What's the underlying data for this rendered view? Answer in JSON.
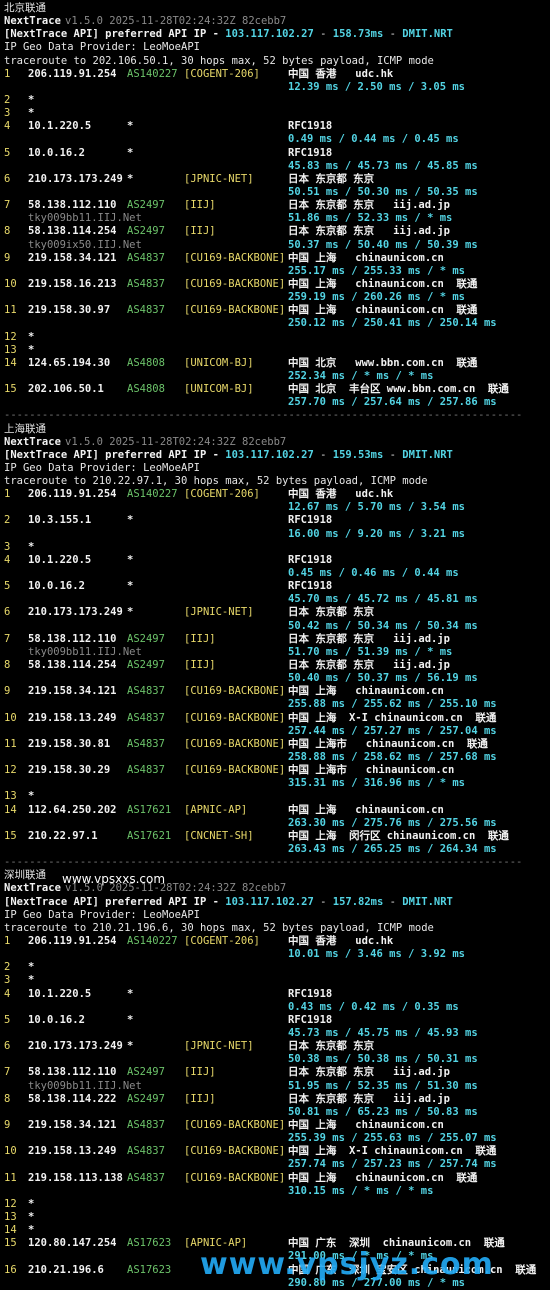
{
  "sections": [
    {
      "region": "北京联通",
      "header": {
        "app": "NextTrace",
        "version": "v1.5.0 2025-11-28T02:24:32Z 82cebb7",
        "api_prefix": "[NextTrace API] preferred API IP - ",
        "api_ip": "103.117.102.27",
        "api_latency": "158.73ms",
        "api_node": "DMIT.NRT",
        "geo_provider": "IP Geo Data Provider: LeoMoeAPI",
        "traceroute": "traceroute to 202.106.50.1, 30 hops max, 52 bytes payload, ICMP mode"
      },
      "hops": [
        {
          "n": "1",
          "ip": "206.119.91.254",
          "asn": "AS140227",
          "tag": "[COGENT-206]",
          "geo": "中国 香港   udc.hk",
          "rtt": "12.39 ms / 2.50 ms / 3.05 ms"
        },
        {
          "n": "2",
          "star": true
        },
        {
          "n": "3",
          "star": true
        },
        {
          "n": "4",
          "ip": "10.1.220.5",
          "asn": "*",
          "geo": "RFC1918",
          "rtt": "0.49 ms / 0.44 ms / 0.45 ms"
        },
        {
          "n": "5",
          "ip": "10.0.16.2",
          "asn": "*",
          "geo": "RFC1918",
          "rtt": "45.83 ms / 45.73 ms / 45.85 ms"
        },
        {
          "n": "6",
          "ip": "210.173.173.249",
          "asn": "*",
          "tag": "[JPNIC-NET]",
          "geo": "日本 东京都 东京",
          "rtt": "50.51 ms / 50.30 ms / 50.35 ms"
        },
        {
          "n": "7",
          "ip": "58.138.112.110",
          "asn": "AS2497",
          "tag": "[IIJ]",
          "geo": "日本 东京都 东京   iij.ad.jp",
          "host": "tky009bb11.IIJ.Net",
          "rtt": "51.86 ms / 52.33 ms / * ms"
        },
        {
          "n": "8",
          "ip": "58.138.114.254",
          "asn": "AS2497",
          "tag": "[IIJ]",
          "geo": "日本 东京都 东京   iij.ad.jp",
          "host": "tky009ix50.IIJ.Net",
          "rtt": "50.37 ms / 50.40 ms / 50.39 ms"
        },
        {
          "n": "9",
          "ip": "219.158.34.121",
          "asn": "AS4837",
          "tag": "[CU169-BACKBONE]",
          "geo": "中国 上海   chinaunicom.cn",
          "rtt": "255.17 ms / 255.33 ms / * ms"
        },
        {
          "n": "10",
          "ip": "219.158.16.213",
          "asn": "AS4837",
          "tag": "[CU169-BACKBONE]",
          "geo": "中国 上海   chinaunicom.cn  联通",
          "rtt": "259.19 ms / 260.26 ms / * ms"
        },
        {
          "n": "11",
          "ip": "219.158.30.97",
          "asn": "AS4837",
          "tag": "[CU169-BACKBONE]",
          "geo": "中国 上海   chinaunicom.cn  联通",
          "rtt": "250.12 ms / 250.41 ms / 250.14 ms"
        },
        {
          "n": "12",
          "star": true
        },
        {
          "n": "13",
          "star": true
        },
        {
          "n": "14",
          "ip": "124.65.194.30",
          "asn": "AS4808",
          "tag": "[UNICOM-BJ]",
          "geo": "中国 北京   www.bbn.com.cn  联通",
          "rtt": "252.34 ms / * ms / * ms"
        },
        {
          "n": "15",
          "ip": "202.106.50.1",
          "asn": "AS4808",
          "tag": "[UNICOM-BJ]",
          "geo": "中国 北京  丰台区 www.bbn.com.cn  联通",
          "rtt": "257.70 ms / 257.64 ms / 257.86 ms"
        }
      ]
    },
    {
      "region": "上海联通",
      "header": {
        "app": "NextTrace",
        "version": "v1.5.0 2025-11-28T02:24:32Z 82cebb7",
        "api_prefix": "[NextTrace API] preferred API IP - ",
        "api_ip": "103.117.102.27",
        "api_latency": "159.53ms",
        "api_node": "DMIT.NRT",
        "geo_provider": "IP Geo Data Provider: LeoMoeAPI",
        "traceroute": "traceroute to 210.22.97.1, 30 hops max, 52 bytes payload, ICMP mode"
      },
      "hops": [
        {
          "n": "1",
          "ip": "206.119.91.254",
          "asn": "AS140227",
          "tag": "[COGENT-206]",
          "geo": "中国 香港   udc.hk",
          "rtt": "12.67 ms / 5.70 ms / 3.54 ms"
        },
        {
          "n": "2",
          "ip": "10.3.155.1",
          "asn": "*",
          "geo": "RFC1918",
          "rtt": "16.00 ms / 9.20 ms / 3.21 ms"
        },
        {
          "n": "3",
          "star": true
        },
        {
          "n": "4",
          "ip": "10.1.220.5",
          "asn": "*",
          "geo": "RFC1918",
          "rtt": "0.45 ms / 0.46 ms / 0.44 ms"
        },
        {
          "n": "5",
          "ip": "10.0.16.2",
          "asn": "*",
          "geo": "RFC1918",
          "rtt": "45.70 ms / 45.72 ms / 45.81 ms"
        },
        {
          "n": "6",
          "ip": "210.173.173.249",
          "asn": "*",
          "tag": "[JPNIC-NET]",
          "geo": "日本 东京都 东京",
          "rtt": "50.42 ms / 50.34 ms / 50.34 ms"
        },
        {
          "n": "7",
          "ip": "58.138.112.110",
          "asn": "AS2497",
          "tag": "[IIJ]",
          "geo": "日本 东京都 东京   iij.ad.jp",
          "host": "tky009bb11.IIJ.Net",
          "rtt": "51.70 ms / 51.39 ms / * ms"
        },
        {
          "n": "8",
          "ip": "58.138.114.254",
          "asn": "AS2497",
          "tag": "[IIJ]",
          "geo": "日本 东京都 东京   iij.ad.jp",
          "rtt": "50.40 ms / 50.37 ms / 56.19 ms"
        },
        {
          "n": "9",
          "ip": "219.158.34.121",
          "asn": "AS4837",
          "tag": "[CU169-BACKBONE]",
          "geo": "中国 上海   chinaunicom.cn",
          "rtt": "255.88 ms / 255.62 ms / 255.10 ms"
        },
        {
          "n": "10",
          "ip": "219.158.13.249",
          "asn": "AS4837",
          "tag": "[CU169-BACKBONE]",
          "geo": "中国 上海  X-I chinaunicom.cn  联通",
          "rtt": "257.44 ms / 257.27 ms / 257.04 ms"
        },
        {
          "n": "11",
          "ip": "219.158.30.81",
          "asn": "AS4837",
          "tag": "[CU169-BACKBONE]",
          "geo": "中国 上海市   chinaunicom.cn  联通",
          "rtt": "258.88 ms / 258.62 ms / 257.68 ms"
        },
        {
          "n": "12",
          "ip": "219.158.30.29",
          "asn": "AS4837",
          "tag": "[CU169-BACKBONE]",
          "geo": "中国 上海市   chinaunicom.cn",
          "rtt": "315.31 ms / 316.96 ms / * ms"
        },
        {
          "n": "13",
          "star": true
        },
        {
          "n": "14",
          "ip": "112.64.250.202",
          "asn": "AS17621",
          "tag": "[APNIC-AP]",
          "geo": "中国 上海   chinaunicom.cn",
          "rtt": "263.30 ms / 275.76 ms / 275.56 ms"
        },
        {
          "n": "15",
          "ip": "210.22.97.1",
          "asn": "AS17621",
          "tag": "[CNCNET-SH]",
          "geo": "中国 上海  闵行区 chinaunicom.cn  联通",
          "rtt": "263.43 ms / 265.25 ms / 264.34 ms"
        }
      ]
    },
    {
      "region": "深圳联通",
      "header": {
        "app": "NextTrace",
        "version": "v1.5.0 2025-11-28T02:24:32Z 82cebb7",
        "api_prefix": "[NextTrace API] preferred API IP - ",
        "api_ip": "103.117.102.27",
        "api_latency": "157.82ms",
        "api_node": "DMIT.NRT",
        "geo_provider": "IP Geo Data Provider: LeoMoeAPI",
        "traceroute": "traceroute to 210.21.196.6, 30 hops max, 52 bytes payload, ICMP mode"
      },
      "hops": [
        {
          "n": "1",
          "ip": "206.119.91.254",
          "asn": "AS140227",
          "tag": "[COGENT-206]",
          "geo": "中国 香港   udc.hk",
          "rtt": "10.01 ms / 3.46 ms / 3.92 ms"
        },
        {
          "n": "2",
          "star": true
        },
        {
          "n": "3",
          "star": true
        },
        {
          "n": "4",
          "ip": "10.1.220.5",
          "asn": "*",
          "geo": "RFC1918",
          "rtt": "0.43 ms / 0.42 ms / 0.35 ms"
        },
        {
          "n": "5",
          "ip": "10.0.16.2",
          "asn": "*",
          "geo": "RFC1918",
          "rtt": "45.73 ms / 45.75 ms / 45.93 ms"
        },
        {
          "n": "6",
          "ip": "210.173.173.249",
          "asn": "*",
          "tag": "[JPNIC-NET]",
          "geo": "日本 东京都 东京",
          "rtt": "50.38 ms / 50.38 ms / 50.31 ms"
        },
        {
          "n": "7",
          "ip": "58.138.112.110",
          "asn": "AS2497",
          "tag": "[IIJ]",
          "geo": "日本 东京都 东京   iij.ad.jp",
          "host": "tky009bb11.IIJ.Net",
          "rtt": "51.95 ms / 52.35 ms / 51.30 ms"
        },
        {
          "n": "8",
          "ip": "58.138.114.222",
          "asn": "AS2497",
          "tag": "[IIJ]",
          "geo": "日本 东京都 东京   iij.ad.jp",
          "rtt": "50.81 ms / 65.23 ms / 50.83 ms"
        },
        {
          "n": "9",
          "ip": "219.158.34.121",
          "asn": "AS4837",
          "tag": "[CU169-BACKBONE]",
          "geo": "中国 上海   chinaunicom.cn",
          "rtt": "255.39 ms / 255.63 ms / 255.07 ms"
        },
        {
          "n": "10",
          "ip": "219.158.13.249",
          "asn": "AS4837",
          "tag": "[CU169-BACKBONE]",
          "geo": "中国 上海  X-I chinaunicom.cn  联通",
          "rtt": "257.74 ms / 257.23 ms / 257.74 ms"
        },
        {
          "n": "11",
          "ip": "219.158.113.138",
          "asn": "AS4837",
          "tag": "[CU169-BACKBONE]",
          "geo": "中国 上海   chinaunicom.cn  联通",
          "rtt": "310.15 ms / * ms / * ms"
        },
        {
          "n": "12",
          "star": true
        },
        {
          "n": "13",
          "star": true
        },
        {
          "n": "14",
          "star": true
        },
        {
          "n": "15",
          "ip": "120.80.147.254",
          "asn": "AS17623",
          "tag": "[APNIC-AP]",
          "geo": "中国 广东  深圳  chinaunicom.cn  联通",
          "rtt": "291.00 ms / * ms / * ms"
        },
        {
          "n": "16",
          "ip": "210.21.196.6",
          "asn": "AS17623",
          "geo": "中国 广东  深圳 宝安区 chinaunicom.cn  联通",
          "rtt": "290.80 ms / 277.00 ms / * ms"
        }
      ]
    }
  ],
  "separator": "----------------------------------------------------------------------------------",
  "watermarks": {
    "small": "www.vpsxxs.com",
    "large": "www.vpsjyz.com"
  },
  "colors": {
    "background": "#000000",
    "text": "#e6e6e6",
    "dim": "#8a8a8a",
    "version": "#8a8a8a",
    "hop_index": "#e8d96a",
    "asn": "#6cc36a",
    "tag": "#e8d96a",
    "rtt": "#53d4e4",
    "api_ip": "#53d4e4",
    "watermark_large": "#22a9f2"
  }
}
